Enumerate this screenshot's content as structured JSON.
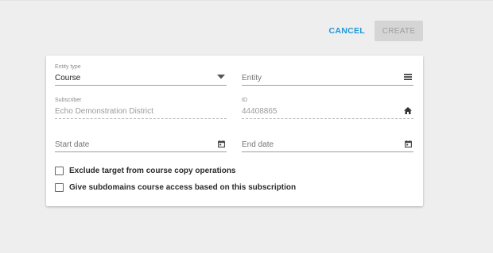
{
  "toolbar": {
    "cancel_label": "CANCEL",
    "create_label": "CREATE"
  },
  "form": {
    "entity_type": {
      "label": "Entity type",
      "value": "Course",
      "icon": "dropdown-arrow-icon"
    },
    "entity": {
      "placeholder": "Entity",
      "icon": "list-icon"
    },
    "subscriber": {
      "label": "Subscriber",
      "value": "Echo Demonstration District"
    },
    "id": {
      "label": "ID",
      "value": "44408865",
      "icon": "home-icon"
    },
    "start_date": {
      "placeholder": "Start date",
      "icon": "calendar-icon"
    },
    "end_date": {
      "placeholder": "End date",
      "icon": "calendar-icon"
    },
    "checkboxes": [
      {
        "label": "Exclude target from course copy operations",
        "checked": false
      },
      {
        "label": "Give subdomains course access based on this subscription",
        "checked": false
      }
    ]
  },
  "colors": {
    "accent": "#2196d3",
    "background": "#eeeeee",
    "card": "#ffffff",
    "disabled_button": "#d5d5d5"
  }
}
